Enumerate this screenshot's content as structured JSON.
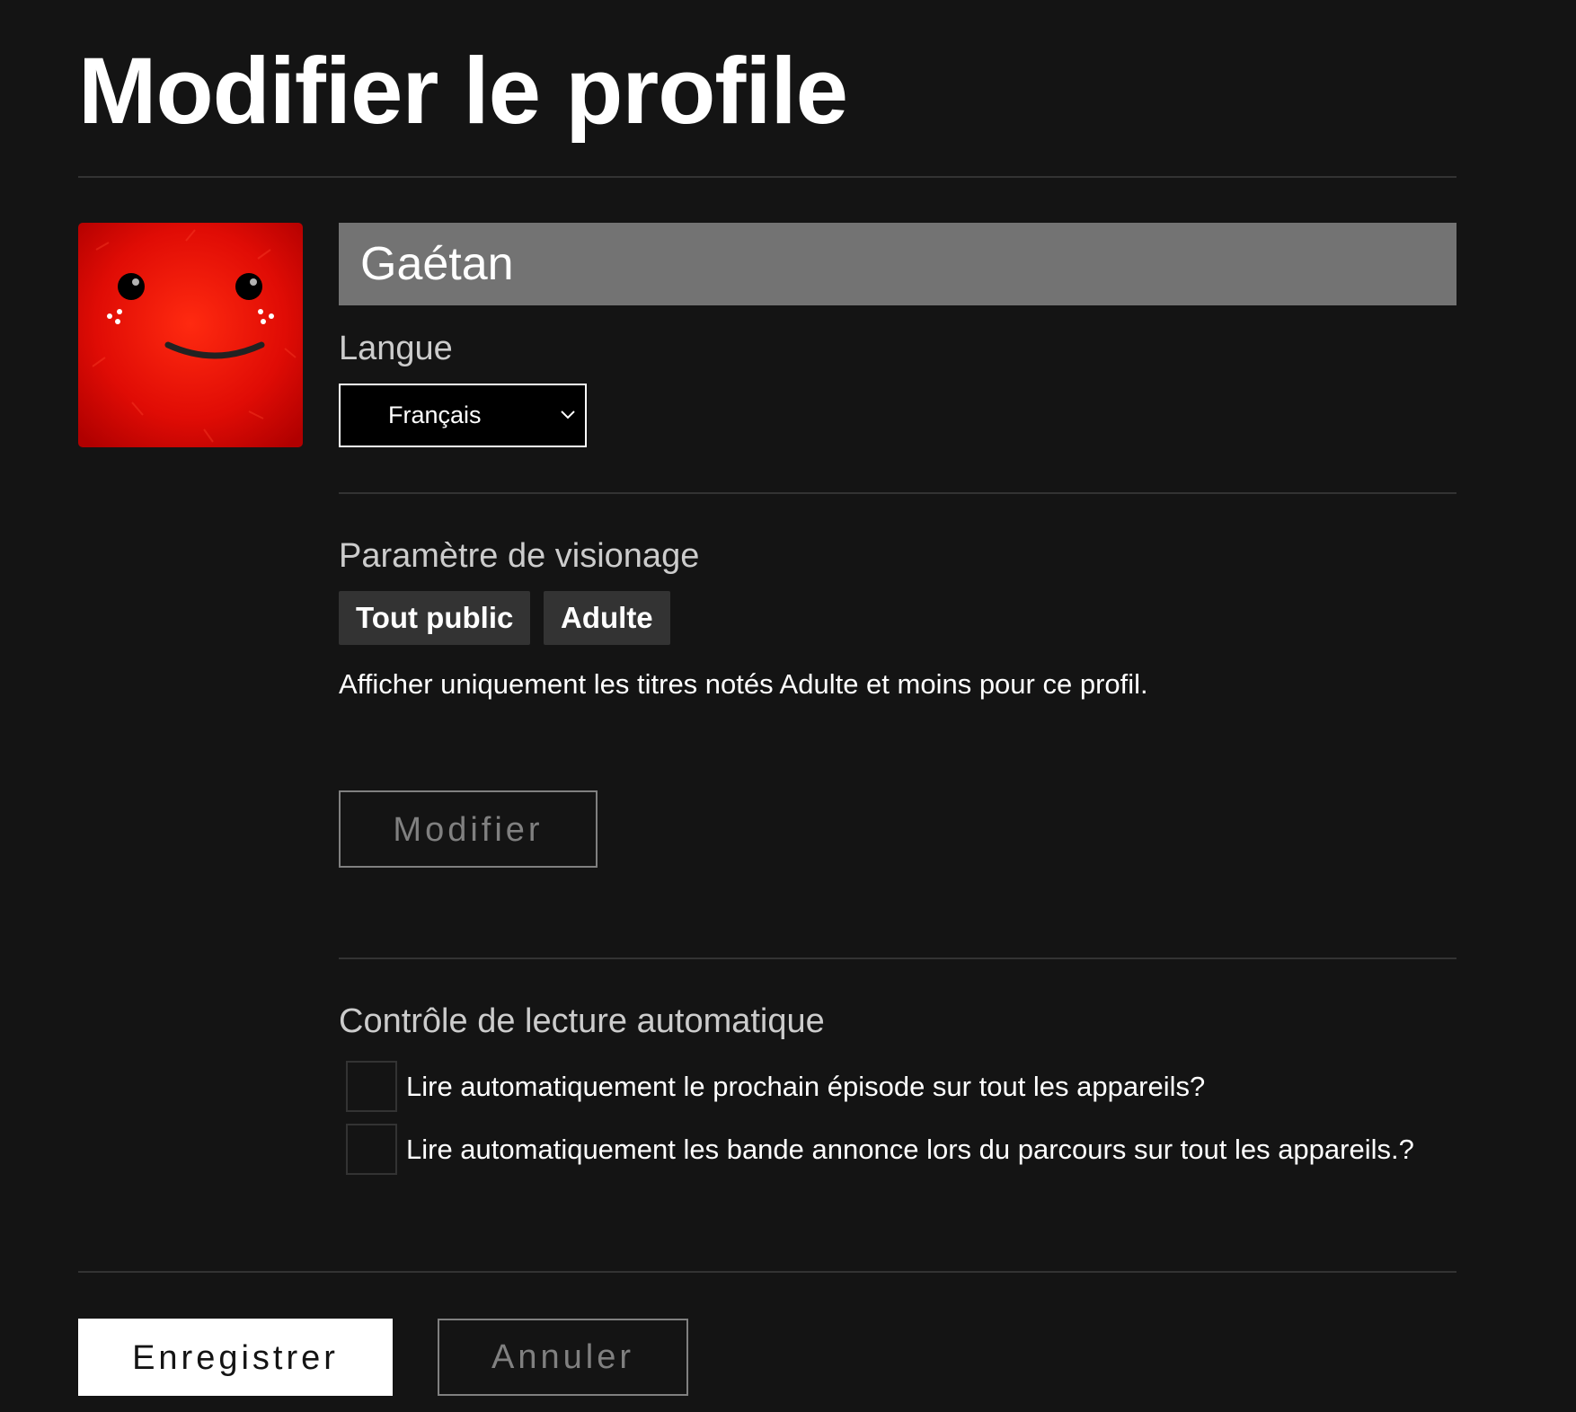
{
  "page": {
    "title": "Modifier le profile"
  },
  "profile": {
    "name_value": "Gaétan",
    "avatar_icon": "red-fluffy-smiley-avatar"
  },
  "language": {
    "label": "Langue",
    "selected": "Français"
  },
  "viewing": {
    "label": "Paramètre de visionage",
    "tags": [
      "Tout public",
      "Adulte"
    ],
    "description": "Afficher uniquement les titres notés Adulte et moins pour ce profil.",
    "modify_label": "Modifier"
  },
  "autoplay": {
    "label": "Contrôle de lecture automatique",
    "options": [
      {
        "label": "Lire automatiquement le prochain épisode sur tout les appareils?",
        "checked": false
      },
      {
        "label": "Lire automatiquement les bande annonce lors du parcours sur tout les appareils.?",
        "checked": false
      }
    ]
  },
  "actions": {
    "save_label": "Enregistrer",
    "cancel_label": "Annuler"
  },
  "colors": {
    "background": "#141414",
    "input_bg": "#737373",
    "tag_bg": "#333333",
    "avatar_red": "#e50914"
  }
}
